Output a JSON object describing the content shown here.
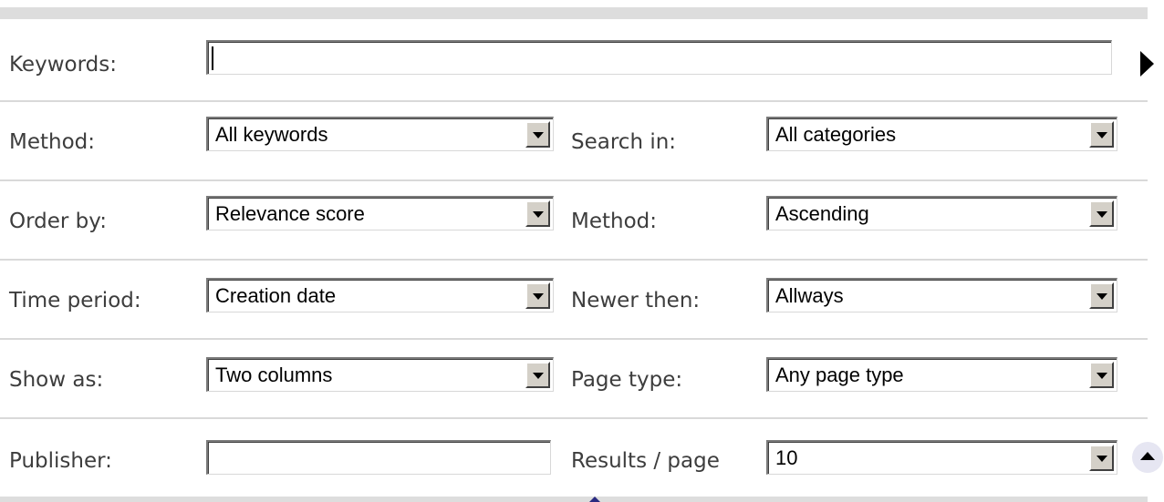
{
  "form": {
    "keywords": {
      "label": "Keywords:",
      "value": ""
    },
    "method": {
      "label": "Method:",
      "selected": "All keywords"
    },
    "search_in": {
      "label": "Search in:",
      "selected": "All categories"
    },
    "order_by": {
      "label": "Order by:",
      "selected": "Relevance score"
    },
    "order_method": {
      "label": "Method:",
      "selected": "Ascending"
    },
    "time_period": {
      "label": "Time period:",
      "selected": "Creation date"
    },
    "newer_then": {
      "label": "Newer then:",
      "selected": "Allways"
    },
    "show_as": {
      "label": "Show as:",
      "selected": "Two columns"
    },
    "page_type": {
      "label": "Page type:",
      "selected": "Any page type"
    },
    "publisher": {
      "label": "Publisher:",
      "value": ""
    },
    "results_per_page": {
      "label": "Results / page",
      "selected": "10"
    }
  },
  "icons": {
    "submit": "play-arrow-icon",
    "back_to_top": "arrow-up-icon",
    "dropdown": "chevron-down-icon"
  }
}
